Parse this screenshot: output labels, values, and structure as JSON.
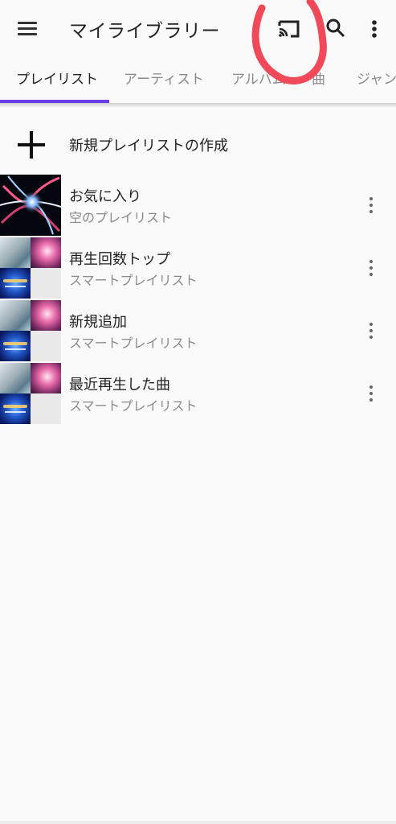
{
  "app_bar": {
    "title": "マイライブラリー",
    "icons": [
      "menu-icon",
      "cast-icon",
      "search-icon",
      "more-vert-icon"
    ]
  },
  "tabs": [
    {
      "label": "プレイリスト",
      "active": true
    },
    {
      "label": "アーティスト",
      "active": false
    },
    {
      "label": "アルバム",
      "active": false
    },
    {
      "label": "曲",
      "active": false
    },
    {
      "label": "ジャンル",
      "active": false
    }
  ],
  "new_playlist": {
    "label": "新規プレイリストの作成",
    "icon": "plus-icon"
  },
  "playlists": [
    {
      "title": "お気に入り",
      "subtitle": "空のプレイリスト"
    },
    {
      "title": "再生回数トップ",
      "subtitle": "スマートプレイリスト"
    },
    {
      "title": "新規追加",
      "subtitle": "スマートプレイリスト"
    },
    {
      "title": "最近再生した曲",
      "subtitle": "スマートプレイリスト"
    }
  ],
  "colors": {
    "accent": "#6a3de8",
    "annotation": "#f04a5a",
    "background": "#fafafa",
    "text_primary": "#222222",
    "text_secondary": "#8a8a8a"
  }
}
